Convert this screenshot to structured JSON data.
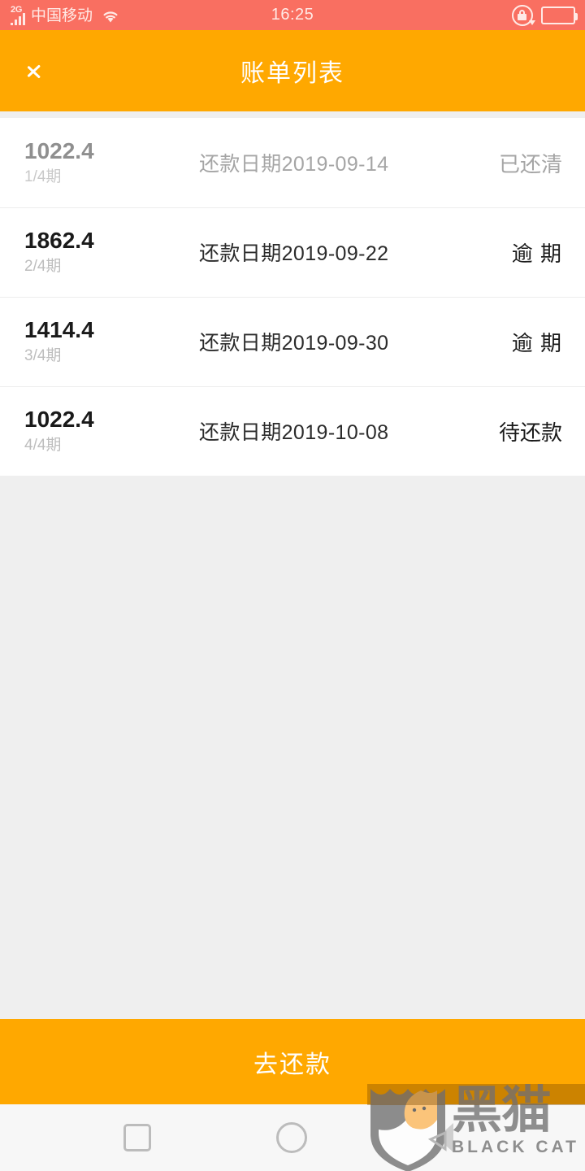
{
  "status_bar": {
    "network_generation": "2G",
    "carrier": "中国移动",
    "wifi_icon": "wifi-icon",
    "time": "16:25",
    "rotation_lock_icon": "rotation-lock-icon",
    "battery_icon": "battery-icon",
    "background_color": "#F96F61",
    "text_color": "#FFEAE6"
  },
  "header": {
    "back_icon": "chevron-left-icon",
    "title": "账单列表",
    "background_color": "#FFA800",
    "text_color": "#FFFFFF"
  },
  "list": {
    "rows": [
      {
        "amount": "1022.4",
        "period": "1/4期",
        "date": "还款日期2019-09-14",
        "status": "已还清",
        "state": "paid"
      },
      {
        "amount": "1862.4",
        "period": "2/4期",
        "date": "还款日期2019-09-22",
        "status": "逾  期",
        "state": "overdue"
      },
      {
        "amount": "1414.4",
        "period": "3/4期",
        "date": "还款日期2019-09-30",
        "status": "逾  期",
        "state": "overdue"
      },
      {
        "amount": "1022.4",
        "period": "4/4期",
        "date": "还款日期2019-10-08",
        "status": "待还款",
        "state": "pending"
      }
    ]
  },
  "cta": {
    "label": "去还款",
    "background_color": "#FFA800",
    "text_color": "#FFFFFF"
  },
  "nav_bar": {
    "recents_icon": "square-recents-icon",
    "home_icon": "circle-home-icon",
    "back_icon": "triangle-back-icon",
    "background_color": "#F7F7F7"
  },
  "watermark": {
    "logo_icon": "black-cat-shield-logo-icon",
    "text_cn": "黑猫",
    "text_en": "BLACK CAT",
    "color": "#8E8E8E"
  }
}
